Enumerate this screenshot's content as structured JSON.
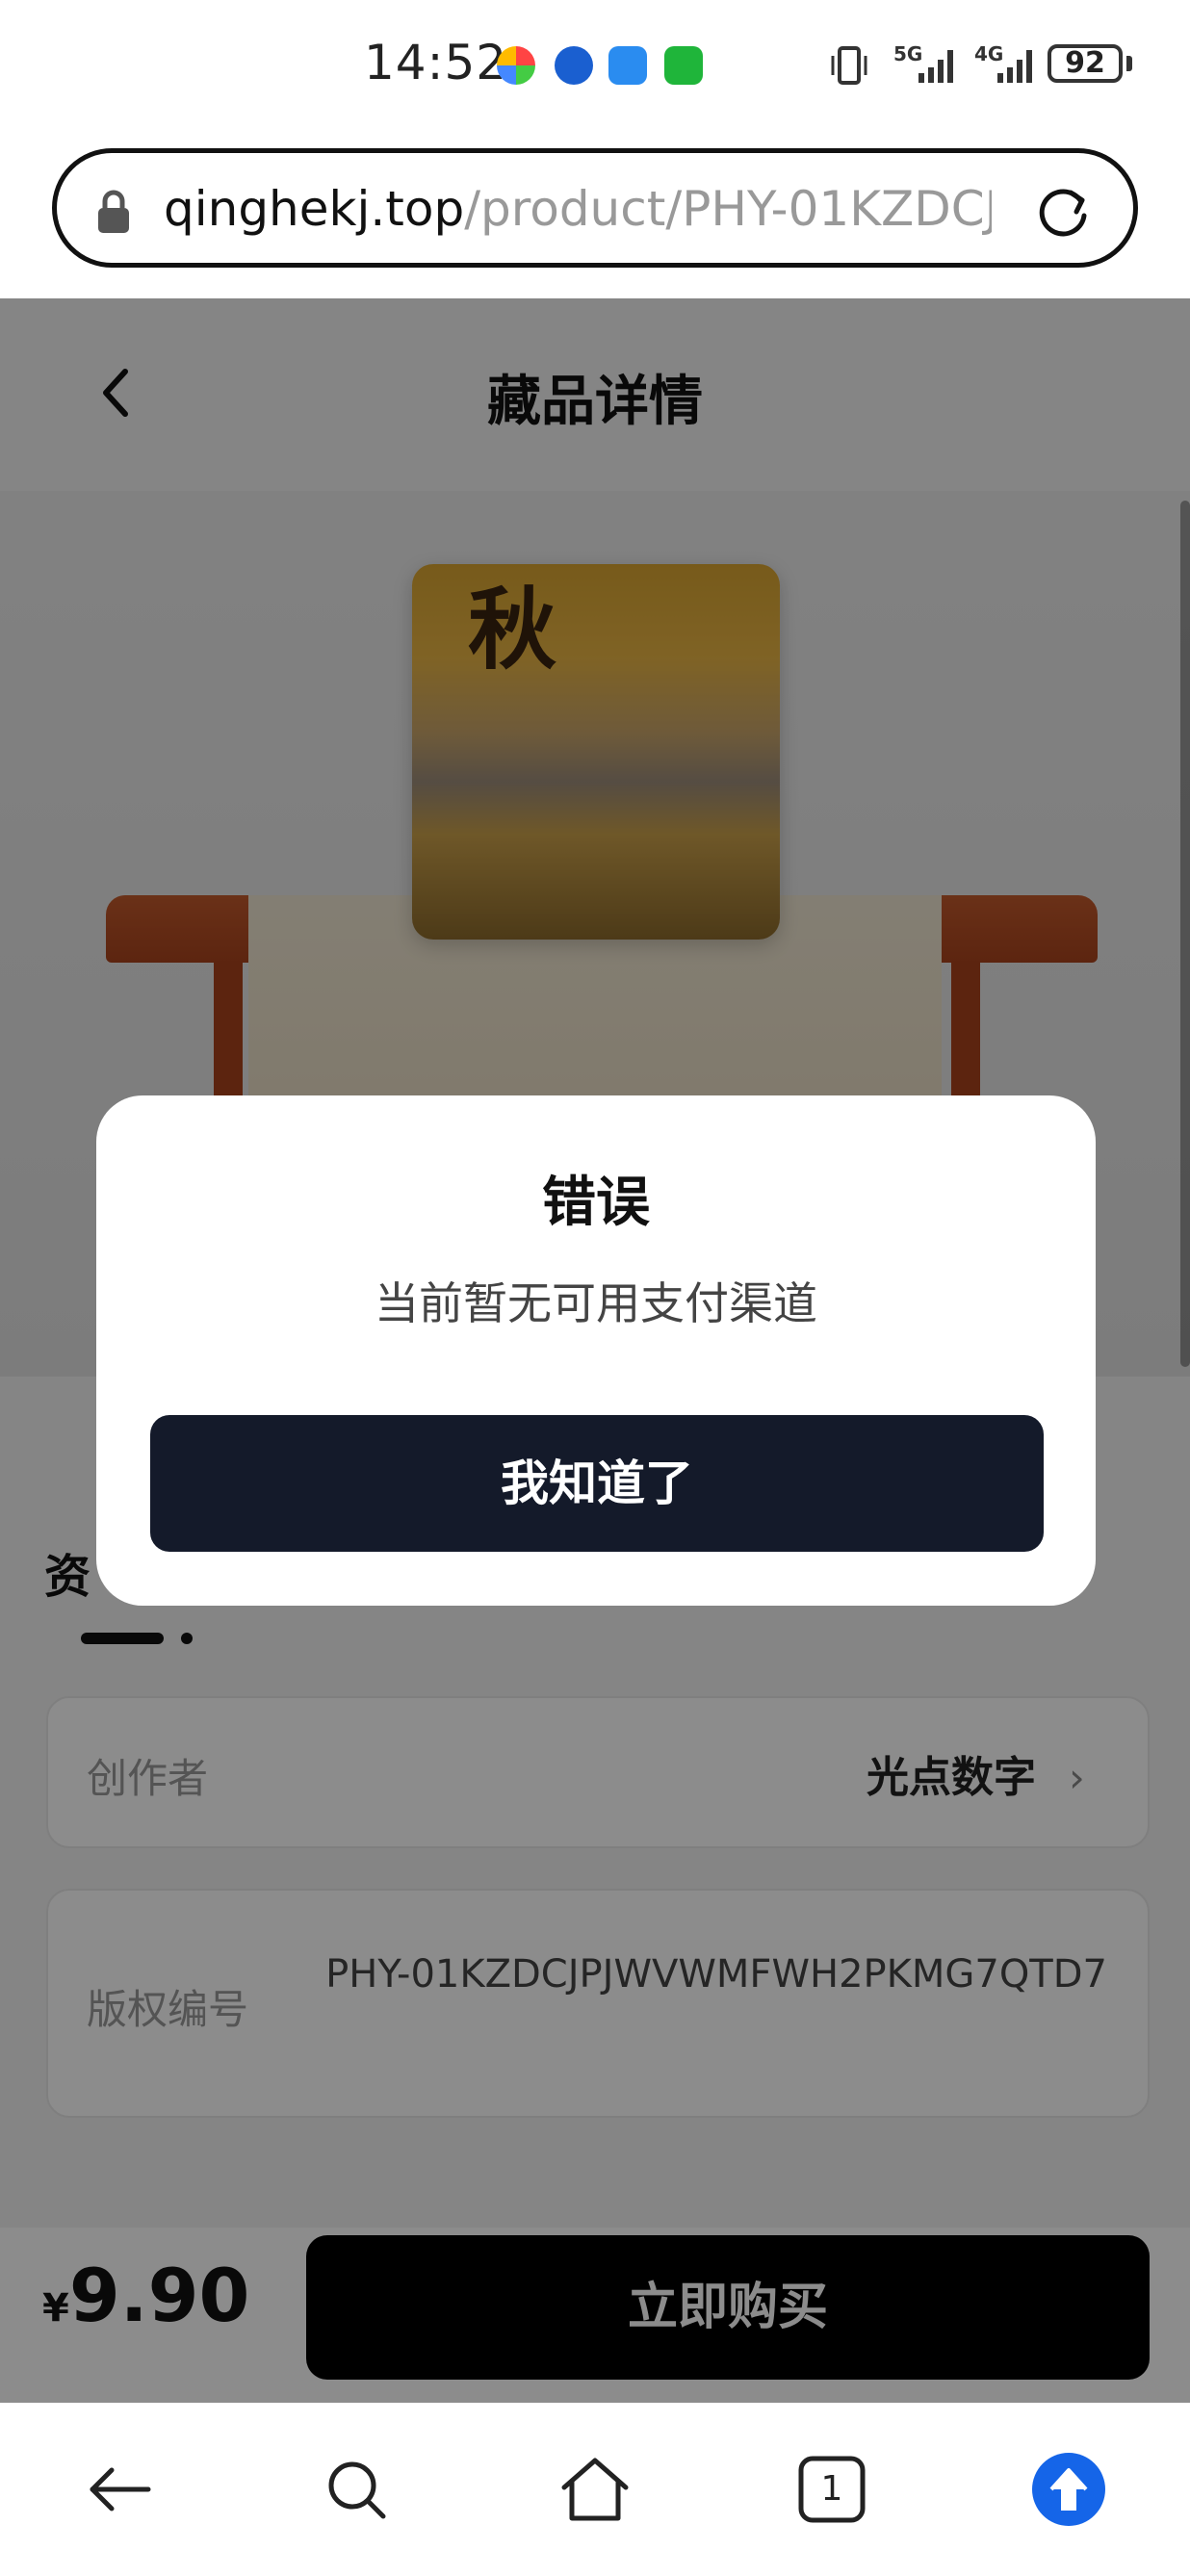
{
  "status_bar": {
    "time": "14:52",
    "battery": "92",
    "signal_1": "5G",
    "signal_2": "4G"
  },
  "url_bar": {
    "host": "qinghekj.top",
    "path": "/product/PHY-01KZDCJ"
  },
  "page": {
    "title": "藏品详情",
    "painting_text": "秋",
    "section_title": "资",
    "creator_label": "创作者",
    "creator_value": "光点数字",
    "copyright_label": "版权编号",
    "copyright_value": "PHY-01KZDCJPJWVWMFWH2PKMG7QTD7",
    "price_symbol": "¥",
    "price": "9.90",
    "buy_button": "立即购买"
  },
  "dialog": {
    "title": "错误",
    "message": "当前暂无可用支付渠道",
    "button": "我知道了"
  },
  "bottom_nav": {
    "tab_count": "1",
    "icons": [
      "back-arrow-icon",
      "search-icon",
      "home-icon",
      "tabs-icon",
      "upload-icon"
    ]
  },
  "colors": {
    "dialog_button": "#141a2a",
    "upload_button": "#1565e8"
  }
}
